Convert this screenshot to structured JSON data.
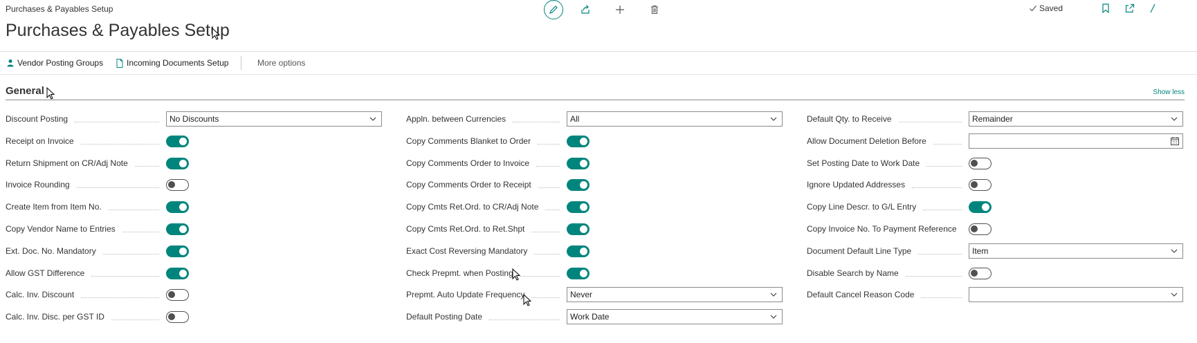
{
  "header": {
    "breadcrumb": "Purchases & Payables Setup",
    "title": "Purchases & Payables Setup",
    "status": "Saved",
    "accent_color": "#00857d"
  },
  "actions": {
    "vendor_posting_groups": "Vendor Posting Groups",
    "incoming_documents_setup": "Incoming Documents Setup",
    "more_options": "More options"
  },
  "section": {
    "title": "General",
    "show_less": "Show less"
  },
  "col1": [
    {
      "label": "Discount Posting",
      "type": "select",
      "value": "No Discounts"
    },
    {
      "label": "Receipt on Invoice",
      "type": "toggle",
      "on": true
    },
    {
      "label": "Return Shipment on CR/Adj Note",
      "type": "toggle",
      "on": true
    },
    {
      "label": "Invoice Rounding",
      "type": "toggle",
      "on": false
    },
    {
      "label": "Create Item from Item No.",
      "type": "toggle",
      "on": true
    },
    {
      "label": "Copy Vendor Name to Entries",
      "type": "toggle",
      "on": true
    },
    {
      "label": "Ext. Doc. No. Mandatory",
      "type": "toggle",
      "on": true
    },
    {
      "label": "Allow GST Difference",
      "type": "toggle",
      "on": true
    },
    {
      "label": "Calc. Inv. Discount",
      "type": "toggle",
      "on": false
    },
    {
      "label": "Calc. Inv. Disc. per GST ID",
      "type": "toggle",
      "on": false
    }
  ],
  "col2": [
    {
      "label": "Appln. between Currencies",
      "type": "select",
      "value": "All"
    },
    {
      "label": "Copy Comments Blanket to Order",
      "type": "toggle",
      "on": true
    },
    {
      "label": "Copy Comments Order to Invoice",
      "type": "toggle",
      "on": true
    },
    {
      "label": "Copy Comments Order to Receipt",
      "type": "toggle",
      "on": true
    },
    {
      "label": "Copy Cmts Ret.Ord. to CR/Adj Note",
      "type": "toggle",
      "on": true
    },
    {
      "label": "Copy Cmts Ret.Ord. to Ret.Shpt",
      "type": "toggle",
      "on": true
    },
    {
      "label": "Exact Cost Reversing Mandatory",
      "type": "toggle",
      "on": true
    },
    {
      "label": "Check Prepmt. when Posting",
      "type": "toggle",
      "on": true
    },
    {
      "label": "Prepmt. Auto Update Frequency",
      "type": "select",
      "value": "Never"
    },
    {
      "label": "Default Posting Date",
      "type": "select",
      "value": "Work Date"
    }
  ],
  "col3": [
    {
      "label": "Default Qty. to Receive",
      "type": "select",
      "value": "Remainder"
    },
    {
      "label": "Allow Document Deletion Before",
      "type": "date",
      "value": ""
    },
    {
      "label": "Set Posting Date to Work Date",
      "type": "toggle",
      "on": false
    },
    {
      "label": "Ignore Updated Addresses",
      "type": "toggle",
      "on": false
    },
    {
      "label": "Copy Line Descr. to G/L Entry",
      "type": "toggle",
      "on": true
    },
    {
      "label": "Copy Invoice No. To Payment Reference",
      "type": "toggle",
      "on": false
    },
    {
      "label": "Document Default Line Type",
      "type": "select",
      "value": "Item"
    },
    {
      "label": "Disable Search by Name",
      "type": "toggle",
      "on": false
    },
    {
      "label": "Default Cancel Reason Code",
      "type": "select",
      "value": ""
    }
  ]
}
